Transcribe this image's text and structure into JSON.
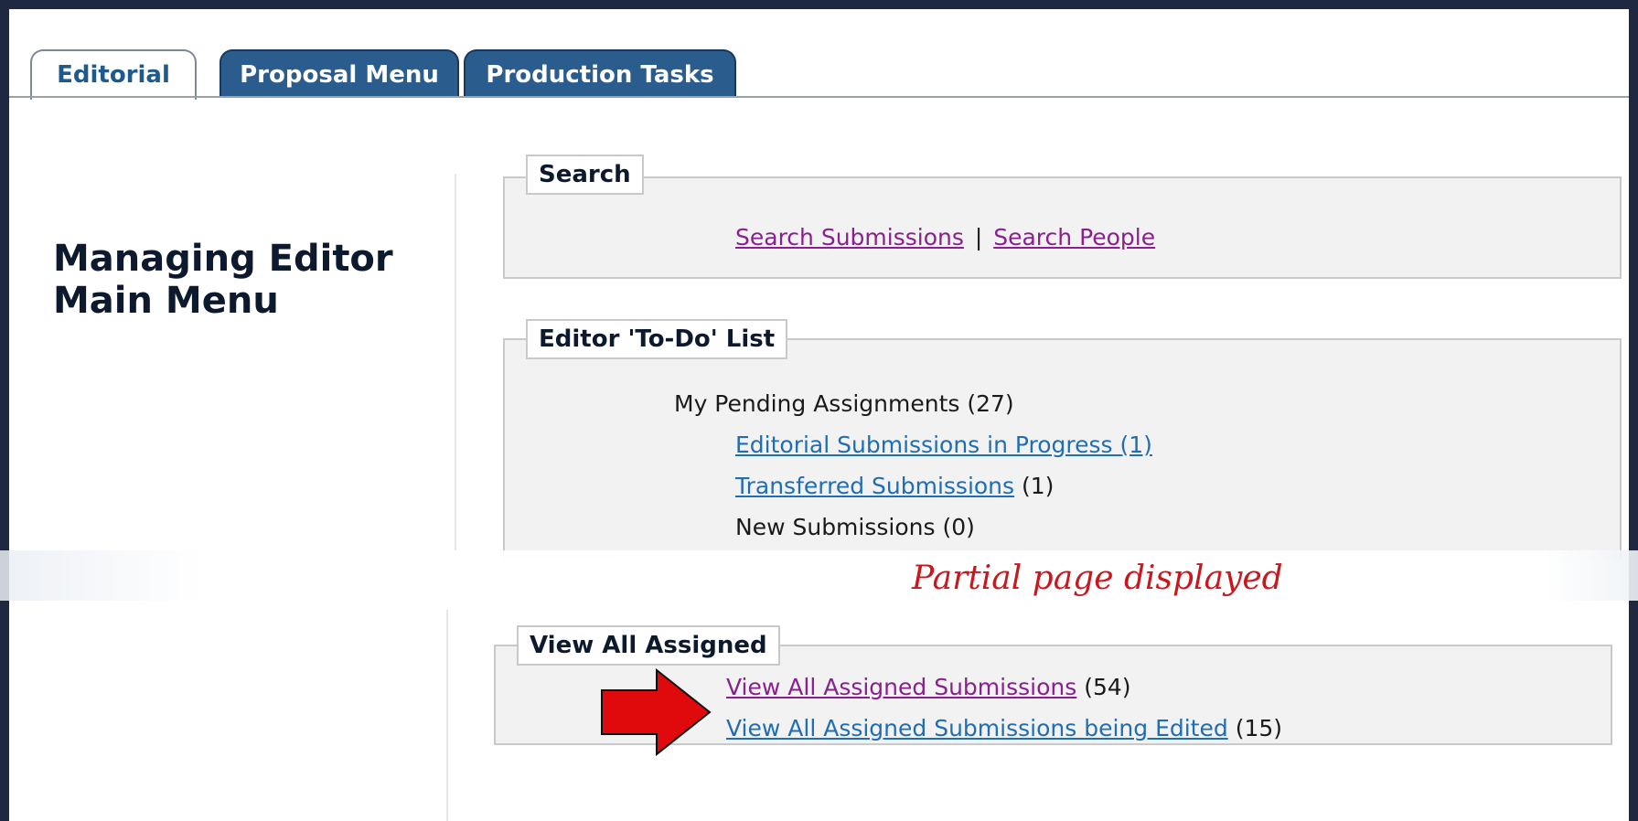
{
  "tabs": [
    {
      "label": "Editorial",
      "active": true
    },
    {
      "label": "Proposal Menu",
      "active": false
    },
    {
      "label": "Production Tasks",
      "active": false
    }
  ],
  "page_title": {
    "line1": "Managing Editor",
    "line2": "Main Menu"
  },
  "search": {
    "legend": "Search",
    "link1": "Search Submissions",
    "separator": "|",
    "link2": "Search People"
  },
  "todo": {
    "legend": "Editor 'To-Do' List",
    "pending_label": "My Pending Assignments (27)",
    "items": [
      {
        "label": "Editorial Submissions in Progress (1)",
        "count": ""
      },
      {
        "label": "Transferred Submissions",
        "count": "(1)"
      },
      {
        "label": "New Submissions (0)",
        "count": ""
      }
    ]
  },
  "annotation": {
    "partial_note": "Partial page displayed",
    "arrow_color": "#e0090b"
  },
  "view_all": {
    "legend": "View All Assigned",
    "items": [
      {
        "label": "View All Assigned Submissions",
        "count": "(54)"
      },
      {
        "label": "View All Assigned Submissions being Edited",
        "count": "(15)"
      }
    ]
  },
  "colors": {
    "accent": "#2a5c8e",
    "link": "#1f6db5",
    "visited_link": "#8a2090",
    "frame": "#1e2840"
  }
}
